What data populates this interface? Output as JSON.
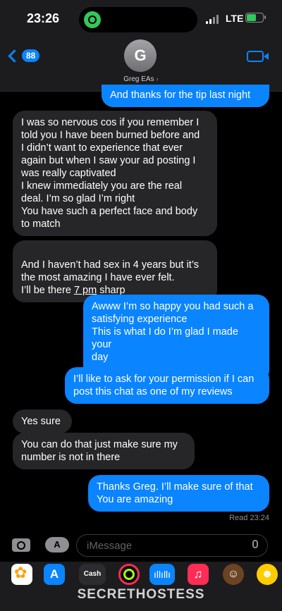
{
  "status_bar": {
    "time": "23:26",
    "network": "LTE"
  },
  "header": {
    "back_count": "88",
    "avatar_initial": "G",
    "contact_name": "Greg EAs",
    "name_chevron": "›"
  },
  "messages": [
    {
      "dir": "out",
      "text": "And thanks for the tip last night"
    },
    {
      "dir": "in",
      "text": "I was so nervous cos if you remember I\ntold you I have been burned before and\nI didn’t want to experience that ever\nagain but when I saw your ad posting I\nwas really captivated\nI knew immediately you are the real\ndeal. I’m so glad I’m right\nYou have such a perfect face and body\nto match"
    },
    {
      "dir": "in",
      "text_pre": "And I haven’t had sex in 4 years but it’s\nthe most amazing I have ever felt.\nI’ll be there ",
      "text_link": "7 pm",
      "text_post": " sharp"
    },
    {
      "dir": "out",
      "text": "Awww I’m so happy you had such a\nsatisfying experience\nThis is what I do I’m glad I made your\nday"
    },
    {
      "dir": "out",
      "text": "I’ll like to ask for your permission if I can\npost this chat as one of my reviews"
    },
    {
      "dir": "in",
      "text": "Yes sure"
    },
    {
      "dir": "in",
      "text": "You can do that just make sure my\nnumber is not in there"
    },
    {
      "dir": "out",
      "text": "Thanks Greg. I’ll make sure of that\nYou are amazing"
    }
  ],
  "read_receipt": "Read 23:24",
  "compose": {
    "placeholder": "iMessage"
  },
  "app_drawer": {
    "apps": [
      "photos-icon",
      "app-store-icon",
      "apple-cash-icon",
      "fitness-icon",
      "voice-memo-icon",
      "music-icon",
      "memoji-icon",
      "memoji-icon"
    ],
    "cash_label": "Cash",
    "store_glyph": "A",
    "music_glyph": "♫",
    "sound_glyph": "ıllıllı"
  },
  "watermark": "SECRETHOSTESS",
  "colors": {
    "outgoing": "#0a84ff",
    "incoming": "#262628",
    "background": "#000000"
  }
}
